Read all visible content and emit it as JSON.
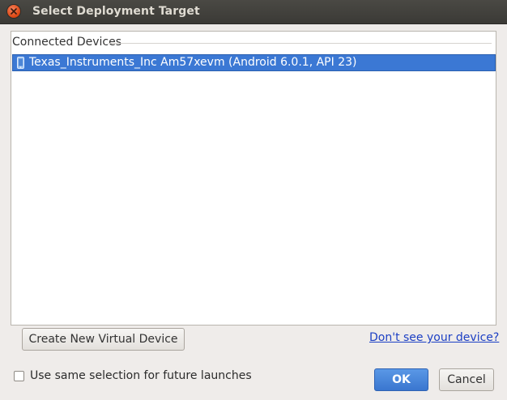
{
  "window": {
    "title": "Select Deployment Target"
  },
  "devices": {
    "section_label": "Connected Devices",
    "items": [
      {
        "label": "Texas_Instruments_Inc Am57xevm (Android 6.0.1, API 23)",
        "icon": "phone-icon",
        "selected": true
      }
    ]
  },
  "actions": {
    "create_label": "Create New Virtual Device",
    "help_link": "Don't see your device?"
  },
  "footer": {
    "checkbox_label": "Use same selection for future launches",
    "checkbox_checked": false,
    "ok_label": "OK",
    "cancel_label": "Cancel"
  },
  "colors": {
    "selection": "#3b78d4",
    "link": "#1c3fc4",
    "close_button": "#dd4814"
  }
}
